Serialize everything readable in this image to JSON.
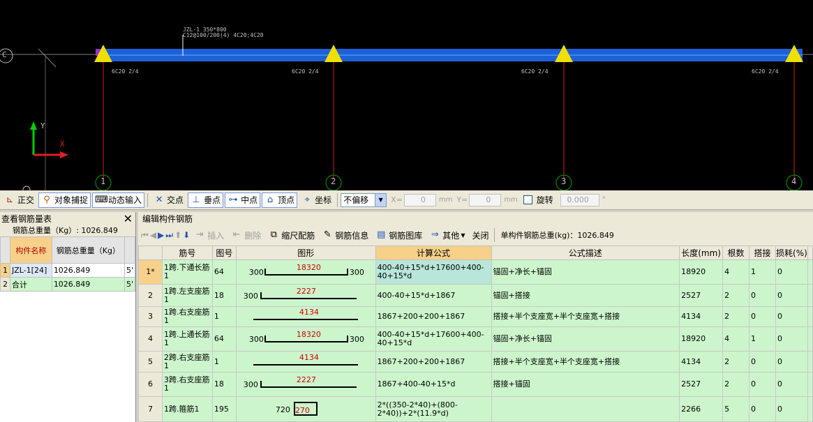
{
  "cad": {
    "beam_label_line1": "JZL-1 350*800",
    "beam_label_line2": "C12@100/200(4) 4C20;4C20",
    "axis_c": "C",
    "axis_labels": [
      "1",
      "2",
      "3",
      "4"
    ],
    "support_rebar_labels": [
      "6C20 2/4",
      "6C20 2/4",
      "6C20 2/4",
      "6C20 2/4"
    ],
    "ucs_y": "Y",
    "ucs_x": "X",
    "colors": {
      "beam": "#1f5fd8",
      "grid_line": "#d02020",
      "support": "#f0e000",
      "axis_circle": "#00a000"
    }
  },
  "snap_toolbar": {
    "ortho": "正交",
    "object_snap": "对象捕捉",
    "dynamic_input": "动态输入",
    "intersection": "交点",
    "perpendicular": "垂点",
    "midpoint": "中点",
    "vertex": "顶点",
    "coordinate": "坐标",
    "offset_select": "不偏移",
    "x_label": "X=",
    "x_value": "0",
    "y_label": "Y=",
    "y_value": "0",
    "unit": "mm",
    "rotate": "旋转",
    "rotate_value": "0.000",
    "degree": "°"
  },
  "left_panel": {
    "title": "查看钢筋量表",
    "total_label": "钢筋总重量（Kg）: 1026.849",
    "col_name": "构件名称",
    "col_weight": "钢筋总重量（Kg）",
    "rows": [
      {
        "idx": "1",
        "name": "JZL-1[24]",
        "weight": "1026.849",
        "extra": "5'"
      },
      {
        "idx": "2",
        "name": "合计",
        "weight": "1026.849",
        "extra": "5'"
      }
    ]
  },
  "edit_panel": {
    "title": "编辑构件钢筋",
    "toolbar": {
      "insert": "插入",
      "delete": "删除",
      "scale_rebar": "缩尺配筋",
      "rebar_info": "钢筋信息",
      "rebar_library": "钢筋图库",
      "other": "其他",
      "close": "关闭",
      "total_weight": "单构件钢筋总重(kg)：1026.849"
    },
    "headers": {
      "bar_no": "筋号",
      "fig_no": "图号",
      "shape": "图形",
      "formula": "计算公式",
      "formula_desc": "公式描述",
      "length": "长度(mm)",
      "count": "根数",
      "lap": "搭接",
      "loss": "损耗(%)"
    },
    "rows": [
      {
        "idx": "1*",
        "name": "1跨.下通长筋1",
        "fig": "64",
        "left": "300",
        "mid": "18320",
        "right": "300",
        "formula": "400-40+15*d+17600+400-40+15*d",
        "desc": "锚固+净长+锚固",
        "length": "18920",
        "count": "4",
        "lap": "1",
        "loss": "0"
      },
      {
        "idx": "2",
        "name": "1跨.左支座筋1",
        "fig": "18",
        "left": "300",
        "mid": "2227",
        "right": "",
        "formula": "400-40+15*d+1867",
        "desc": "锚固+搭接",
        "length": "2527",
        "count": "2",
        "lap": "0",
        "loss": "0"
      },
      {
        "idx": "3",
        "name": "1跨.右支座筋1",
        "fig": "1",
        "left": "",
        "mid": "4134",
        "right": "",
        "formula": "1867+200+200+1867",
        "desc": "搭接+半个支座宽+半个支座宽+搭接",
        "length": "4134",
        "count": "2",
        "lap": "0",
        "loss": "0"
      },
      {
        "idx": "4",
        "name": "1跨.上通长筋1",
        "fig": "64",
        "left": "300",
        "mid": "18320",
        "right": "300",
        "formula": "400-40+15*d+17600+400-40+15*d",
        "desc": "锚固+净长+锚固",
        "length": "18920",
        "count": "4",
        "lap": "1",
        "loss": "0"
      },
      {
        "idx": "5",
        "name": "2跨.右支座筋1",
        "fig": "1",
        "left": "",
        "mid": "4134",
        "right": "",
        "formula": "1867+200+200+1867",
        "desc": "搭接+半个支座宽+半个支座宽+搭接",
        "length": "4134",
        "count": "2",
        "lap": "0",
        "loss": "0"
      },
      {
        "idx": "6",
        "name": "3跨.右支座筋1",
        "fig": "18",
        "left": "300",
        "mid": "2227",
        "right": "",
        "formula": "1867+400-40+15*d",
        "desc": "搭接+锚固",
        "length": "2527",
        "count": "2",
        "lap": "0",
        "loss": "0"
      },
      {
        "idx": "7",
        "name": "1跨.箍筋1",
        "fig": "195",
        "left": "720",
        "mid": "270",
        "right": "",
        "formula": "2*((350-2*40)+(800-2*40))+2*(11.9*d)",
        "desc": "",
        "length": "2266",
        "count": "5",
        "lap": "0",
        "loss": "0"
      }
    ]
  }
}
